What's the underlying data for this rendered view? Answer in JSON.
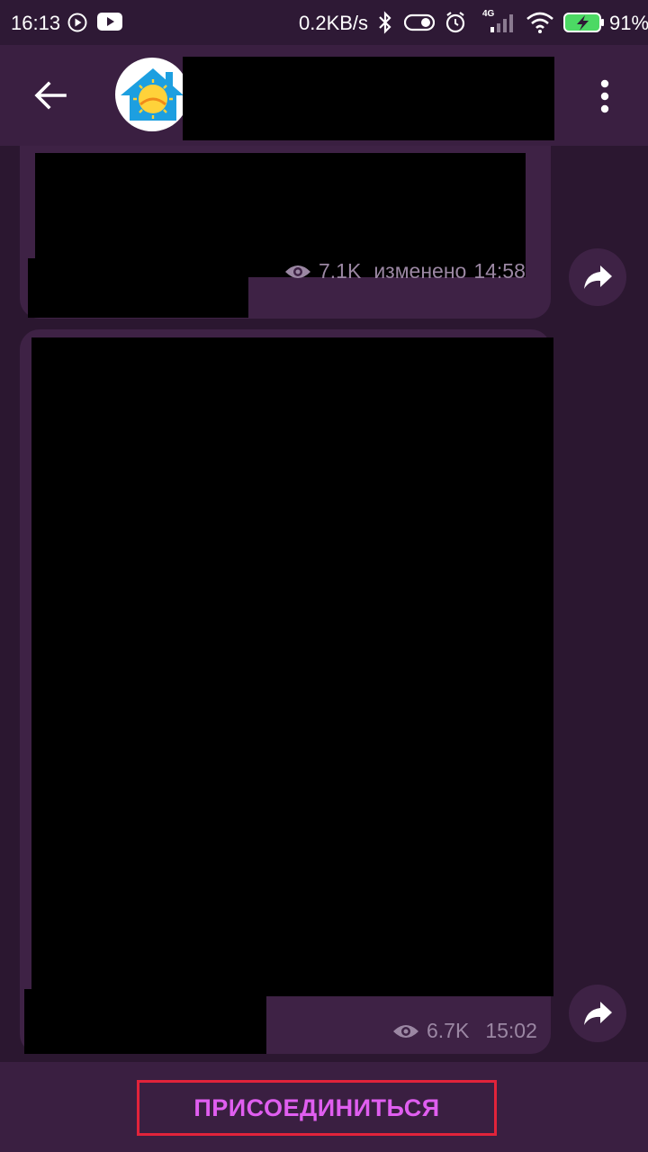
{
  "status_bar": {
    "time": "16:13",
    "network_speed": "0.2KB/s",
    "network_type": "4G",
    "battery_percent": "91%",
    "icons": [
      "play-circle-icon",
      "youtube-icon",
      "bluetooth-icon",
      "toggle-icon",
      "alarm-icon",
      "signal-icon",
      "wifi-icon",
      "battery-charging-icon"
    ]
  },
  "header": {
    "back_icon": "arrow-left-icon",
    "avatar_icon": "sun-house-logo-icon",
    "menu_icon": "more-vertical-icon"
  },
  "messages": [
    {
      "views": "7.1K",
      "edited_label": "изменено",
      "time": "14:58"
    },
    {
      "views": "6.7K",
      "time": "15:02"
    }
  ],
  "join_bar": {
    "join_label": "ПРИСОЕДИНИТЬСЯ"
  },
  "colors": {
    "background": "#2b1730",
    "header": "#3a1f41",
    "bubble": "#3e2245",
    "meta_text": "#9b87a3",
    "join_text": "#e05ef0",
    "highlight_border": "#e1233a"
  }
}
